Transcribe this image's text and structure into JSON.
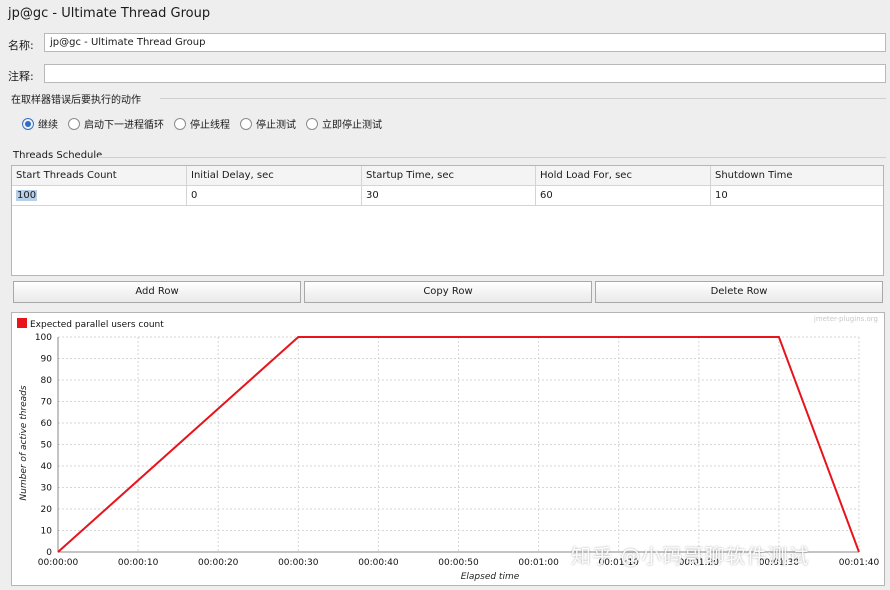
{
  "window_title": "jp@gc - Ultimate Thread Group",
  "name_field": {
    "label": "名称:",
    "value": "jp@gc - Ultimate Thread Group"
  },
  "comment_field": {
    "label": "注释:",
    "value": ""
  },
  "error_action": {
    "group_title": "在取样器错误后要执行的动作",
    "options": [
      {
        "label": "继续",
        "selected": true
      },
      {
        "label": "启动下一进程循环",
        "selected": false
      },
      {
        "label": "停止线程",
        "selected": false
      },
      {
        "label": "停止测试",
        "selected": false
      },
      {
        "label": "立即停止测试",
        "selected": false
      }
    ]
  },
  "threads_schedule": {
    "group_title": "Threads Schedule",
    "columns": [
      "Start Threads Count",
      "Initial Delay, sec",
      "Startup Time, sec",
      "Hold Load For, sec",
      "Shutdown Time"
    ],
    "rows": [
      [
        "100",
        "0",
        "30",
        "60",
        "10"
      ]
    ],
    "buttons": {
      "add": "Add Row",
      "copy": "Copy Row",
      "delete": "Delete Row"
    }
  },
  "chart_data": {
    "type": "line",
    "legend": "Expected parallel users count",
    "legend_color": "#e8141b",
    "brand": "jmeter-plugins.org",
    "xlabel": "Elapsed time",
    "ylabel": "Number of active threads",
    "ylim": [
      0,
      100
    ],
    "yticks": [
      "100",
      "90",
      "80",
      "70",
      "60",
      "50",
      "40",
      "30",
      "20",
      "10",
      "0"
    ],
    "xticks": [
      "00:00:00",
      "00:00:10",
      "00:00:20",
      "00:00:30",
      "00:00:40",
      "00:00:50",
      "00:01:00",
      "00:01:10",
      "00:01:20",
      "00:01:30",
      "00:01:40"
    ],
    "series": [
      {
        "name": "Expected parallel users count",
        "color": "#e8141b",
        "x_seconds": [
          0,
          30,
          90,
          100
        ],
        "y": [
          0,
          100,
          100,
          0
        ]
      }
    ]
  },
  "watermark": "知乎 @小码哥聊软件测试"
}
